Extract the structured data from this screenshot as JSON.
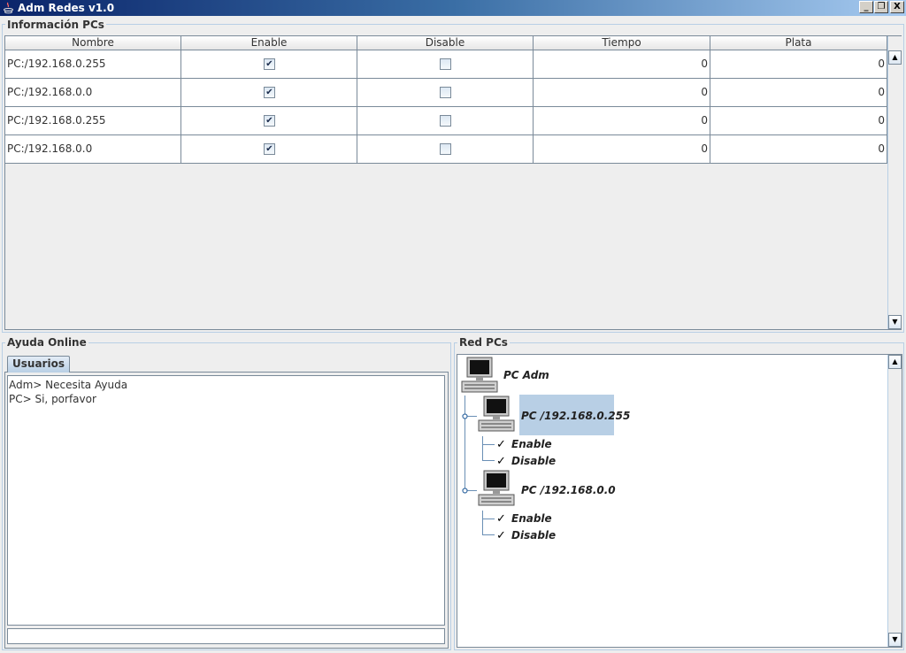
{
  "window": {
    "title": "Adm Redes v1.0",
    "minimize_glyph": "_",
    "maximize_glyph": "❐",
    "close_glyph": "X"
  },
  "info_pcs": {
    "group_title": "Información PCs",
    "columns": [
      "Nombre",
      "Enable",
      "Disable",
      "Tiempo",
      "Plata"
    ],
    "rows": [
      {
        "nombre": "PC:/192.168.0.255",
        "enable": true,
        "disable": false,
        "tiempo": "0",
        "plata": "0"
      },
      {
        "nombre": "PC:/192.168.0.0",
        "enable": true,
        "disable": false,
        "tiempo": "0",
        "plata": "0"
      },
      {
        "nombre": "PC:/192.168.0.255",
        "enable": true,
        "disable": false,
        "tiempo": "0",
        "plata": "0"
      },
      {
        "nombre": "PC:/192.168.0.0",
        "enable": true,
        "disable": false,
        "tiempo": "0",
        "plata": "0"
      }
    ],
    "check_glyph": "✔"
  },
  "ayuda_online": {
    "group_title": "Ayuda Online",
    "tab_label": "Usuarios",
    "messages": [
      "Adm> Necesita Ayuda",
      "PC> Si, porfavor"
    ],
    "input_value": ""
  },
  "red_pcs": {
    "group_title": "Red PCs",
    "root_label": "PC Adm",
    "nodes": [
      {
        "label": "PC /192.168.0.255",
        "children": [
          "Enable",
          "Disable"
        ]
      },
      {
        "label": "PC /192.168.0.0",
        "children": [
          "Enable",
          "Disable"
        ]
      }
    ],
    "check_glyph": "✓"
  },
  "colors": {
    "title_gradient_start": "#0a246a",
    "selection": "#b8cfe5",
    "border": "#7a8a99"
  },
  "scroll": {
    "up_glyph": "▲",
    "down_glyph": "▼"
  }
}
